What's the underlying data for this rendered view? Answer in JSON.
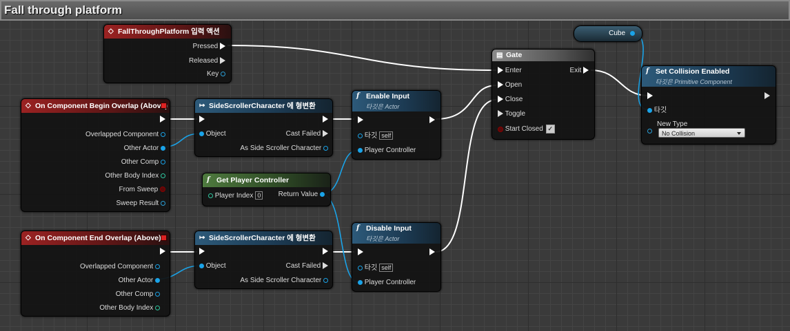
{
  "header": {
    "title": "Fall through platform"
  },
  "input_action": {
    "title": "FallThroughPlatform 입력 액션",
    "pins": {
      "pressed": "Pressed",
      "released": "Released",
      "key": "Key"
    }
  },
  "begin_overlap": {
    "title": "On Component Begin Overlap (Above)",
    "pins": [
      "Overlapped Component",
      "Other Actor",
      "Other Comp",
      "Other Body Index",
      "From Sweep",
      "Sweep Result"
    ]
  },
  "end_overlap": {
    "title": "On Component End Overlap (Above)",
    "pins": [
      "Overlapped Component",
      "Other Actor",
      "Other Comp",
      "Other Body Index"
    ]
  },
  "cast1": {
    "title": "SideScrollerCharacter 에 형변환",
    "object": "Object",
    "cast_failed": "Cast Failed",
    "as": "As Side Scroller Character"
  },
  "cast2": {
    "title": "SideScrollerCharacter 에 형변환",
    "object": "Object",
    "cast_failed": "Cast Failed",
    "as": "As Side Scroller Character"
  },
  "enable_input": {
    "title": "Enable Input",
    "subtitle": "타깃은 Actor",
    "target": "타깃",
    "self": "self",
    "pc": "Player Controller"
  },
  "disable_input": {
    "title": "Disable Input",
    "subtitle": "타깃은 Actor",
    "target": "타깃",
    "self": "self",
    "pc": "Player Controller"
  },
  "get_pc": {
    "title": "Get Player Controller",
    "player_index": "Player Index",
    "index_value": "0",
    "return_value": "Return Value"
  },
  "gate": {
    "title": "Gate",
    "enter": "Enter",
    "open": "Open",
    "close": "Close",
    "toggle": "Toggle",
    "start_closed": "Start Closed",
    "exit": "Exit",
    "start_closed_checked": true
  },
  "cube": {
    "label": "Cube"
  },
  "set_collision": {
    "title": "Set Collision Enabled",
    "subtitle": "타깃은 Primitive Component",
    "target": "타깃",
    "new_type_label": "New Type",
    "new_type_value": "No Collision"
  },
  "icons": {
    "function": "f",
    "event": "event-diamond-icon",
    "cast": "cast-arrow-icon",
    "gate": "gate-icon"
  },
  "colors": {
    "exec": "#ffffff",
    "object_pin": "#1aa3e8",
    "event_title": "#9b2222",
    "pure_title": "#4e7a3e",
    "function_title": "#2d5a7a"
  }
}
